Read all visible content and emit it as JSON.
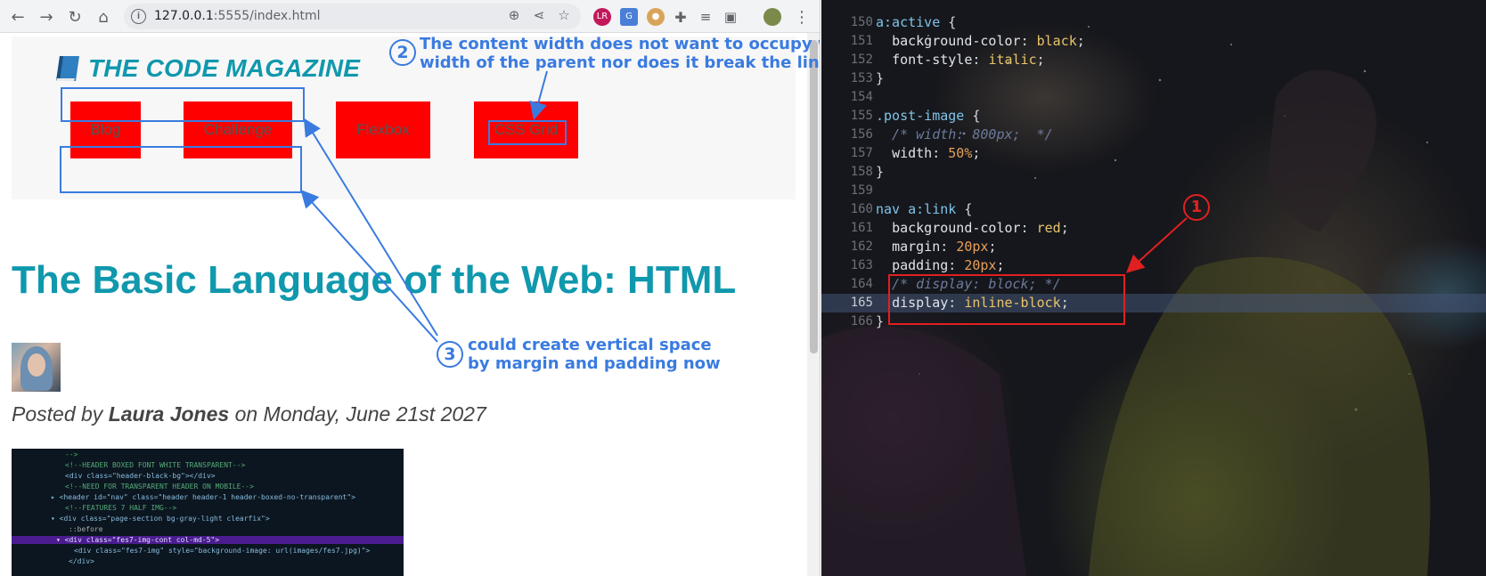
{
  "browser": {
    "url_host": "127.0.0.1",
    "url_rest": ":5555/index.html"
  },
  "site": {
    "brand": "THE CODE MAGAZINE",
    "nav": [
      "Blog",
      "Challenge",
      "Flexbox",
      "CSS Grid"
    ],
    "post_title": "The Basic Language of the Web: HTML",
    "byline_prefix": "Posted by ",
    "byline_author": "Laura Jones",
    "byline_suffix": " on Monday, June 21st 2027"
  },
  "annotations": {
    "note1_number": "1",
    "note2_number": "2",
    "note2_line1": "The content width does not want to occupy whole",
    "note2_line2": "width of the parent nor does it break the line",
    "note3_number": "3",
    "note3_line1": "could create vertical space",
    "note3_line2": "by margin and padding now"
  },
  "editor": {
    "lines": [
      {
        "n": "150",
        "code": "a:active {"
      },
      {
        "n": "151",
        "code": "  background-color: black;"
      },
      {
        "n": "152",
        "code": "  font-style: italic;"
      },
      {
        "n": "153",
        "code": "}"
      },
      {
        "n": "154",
        "code": ""
      },
      {
        "n": "155",
        "code": ".post-image {"
      },
      {
        "n": "156",
        "code": "  /* width: 800px;  */"
      },
      {
        "n": "157",
        "code": "  width: 50%;"
      },
      {
        "n": "158",
        "code": "}"
      },
      {
        "n": "159",
        "code": ""
      },
      {
        "n": "160",
        "code": "nav a:link {"
      },
      {
        "n": "161",
        "code": "  background-color: red;"
      },
      {
        "n": "162",
        "code": "  margin: 20px;"
      },
      {
        "n": "163",
        "code": "  padding: 20px;"
      },
      {
        "n": "164",
        "code": "  /* display: block; */"
      },
      {
        "n": "165",
        "code": "  display: inline-block;"
      },
      {
        "n": "166",
        "code": "}"
      }
    ],
    "current_line": "165"
  },
  "colors": {
    "accent": "#1098ad",
    "nav_bg": "#ff0000",
    "annotation_blue": "#3a7be0",
    "annotation_red": "#e02020"
  }
}
